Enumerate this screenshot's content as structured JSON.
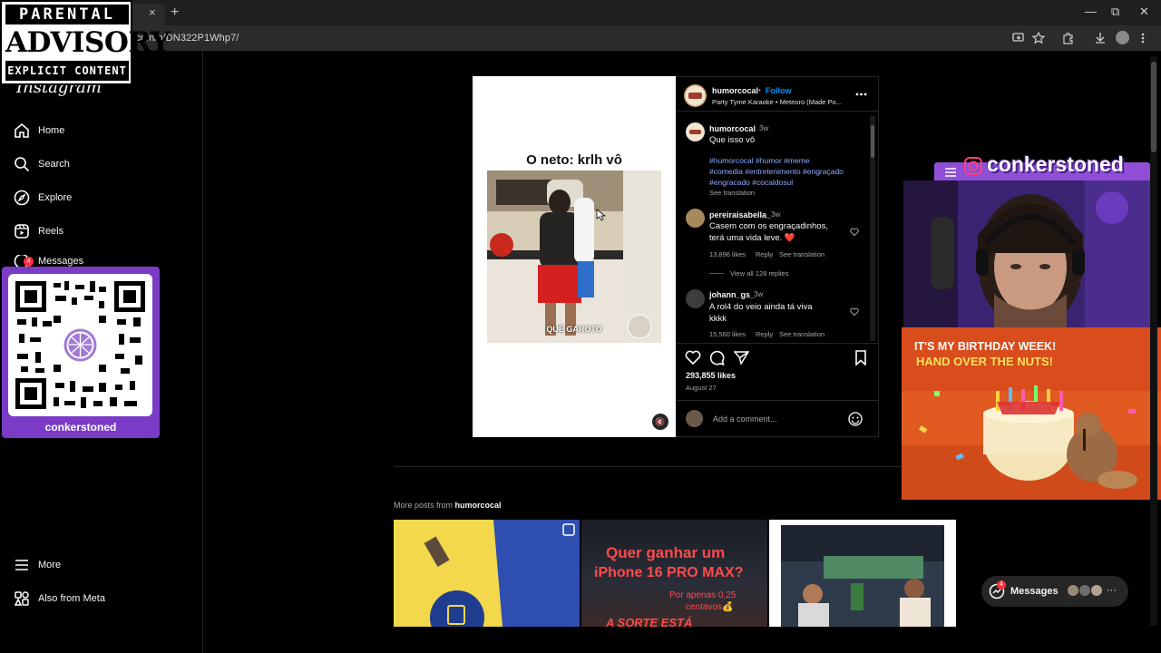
{
  "browser": {
    "url": ".com/p/DN322P1Whp7/",
    "tab_close": "×",
    "new_tab": "+",
    "window_buttons": [
      "—",
      "⧉",
      "✕"
    ]
  },
  "advisory": {
    "line1": "PARENTAL",
    "line2": "ADVISORY",
    "line3": "EXPLICIT CONTENT"
  },
  "sidebar": {
    "logo": "Instagram",
    "items": [
      {
        "label": "Home",
        "icon": "home-icon"
      },
      {
        "label": "Search",
        "icon": "search-icon"
      },
      {
        "label": "Explore",
        "icon": "explore-icon"
      },
      {
        "label": "Reels",
        "icon": "reels-icon"
      },
      {
        "label": "Messages",
        "icon": "messages-icon",
        "badge": "4"
      }
    ],
    "bottom_items": [
      {
        "label": "More",
        "icon": "menu-icon"
      },
      {
        "label": "Also from Meta",
        "icon": "meta-icon"
      }
    ]
  },
  "qr": {
    "label": "conkerstoned"
  },
  "post": {
    "caption": "O neto: krlh vô",
    "video_subtitle": "QUÉ GAROTO",
    "header": {
      "username": "humorcocal",
      "separator": "•",
      "follow": "Follow",
      "audio": "Party Tyme Karaoke • Meteoro (Made Po..."
    },
    "author_comment": {
      "username": "humorcocal",
      "time": "3w",
      "text": "Que isso vô",
      "hashtags_line1": "#humorcocal #humor #meme",
      "hashtags_line2": "#comedia #entretenimento #engraçado",
      "hashtags_line3": "#engracado #cocaldosul",
      "see_translation": "See translation"
    },
    "comments": [
      {
        "username": "pereiraisabella_",
        "time": "3w",
        "line1": "Casem com os engraçadinhos,",
        "line2": "terá uma vida leve. ❤️",
        "likes": "13,896 likes",
        "reply": "Reply",
        "see_translation": "See translation",
        "view_replies": "View all 128 replies"
      },
      {
        "username": "johann_gs_",
        "time": "3w",
        "line1": "A rol4 do veio ainda tá viva",
        "line2": "kkkk",
        "likes": "15,560 likes",
        "reply": "Reply",
        "see_translation": "See translation"
      }
    ],
    "likes": "293,855 likes",
    "date": "August 27",
    "add_comment_placeholder": "Add a comment..."
  },
  "more_posts": {
    "prefix": "More posts from",
    "username": "humorcocal"
  },
  "grid": [
    {
      "caption": ""
    },
    {
      "line1": "Quer ganhar um",
      "line2": "iPhone 16 PRO MAX?",
      "line3": "Por apenas 0,25",
      "line4": "centavos💰",
      "line5": "A SORTE ESTÁ"
    },
    {
      "caption": ""
    }
  ],
  "stream": {
    "name": "conkerstoned",
    "bday_line1": "IT'S MY BIRTHDAY WEEK!",
    "bday_line2": "HAND OVER THE NUTS!"
  },
  "messages_pill": {
    "label": "Messages",
    "badge": "4",
    "more": "···"
  }
}
